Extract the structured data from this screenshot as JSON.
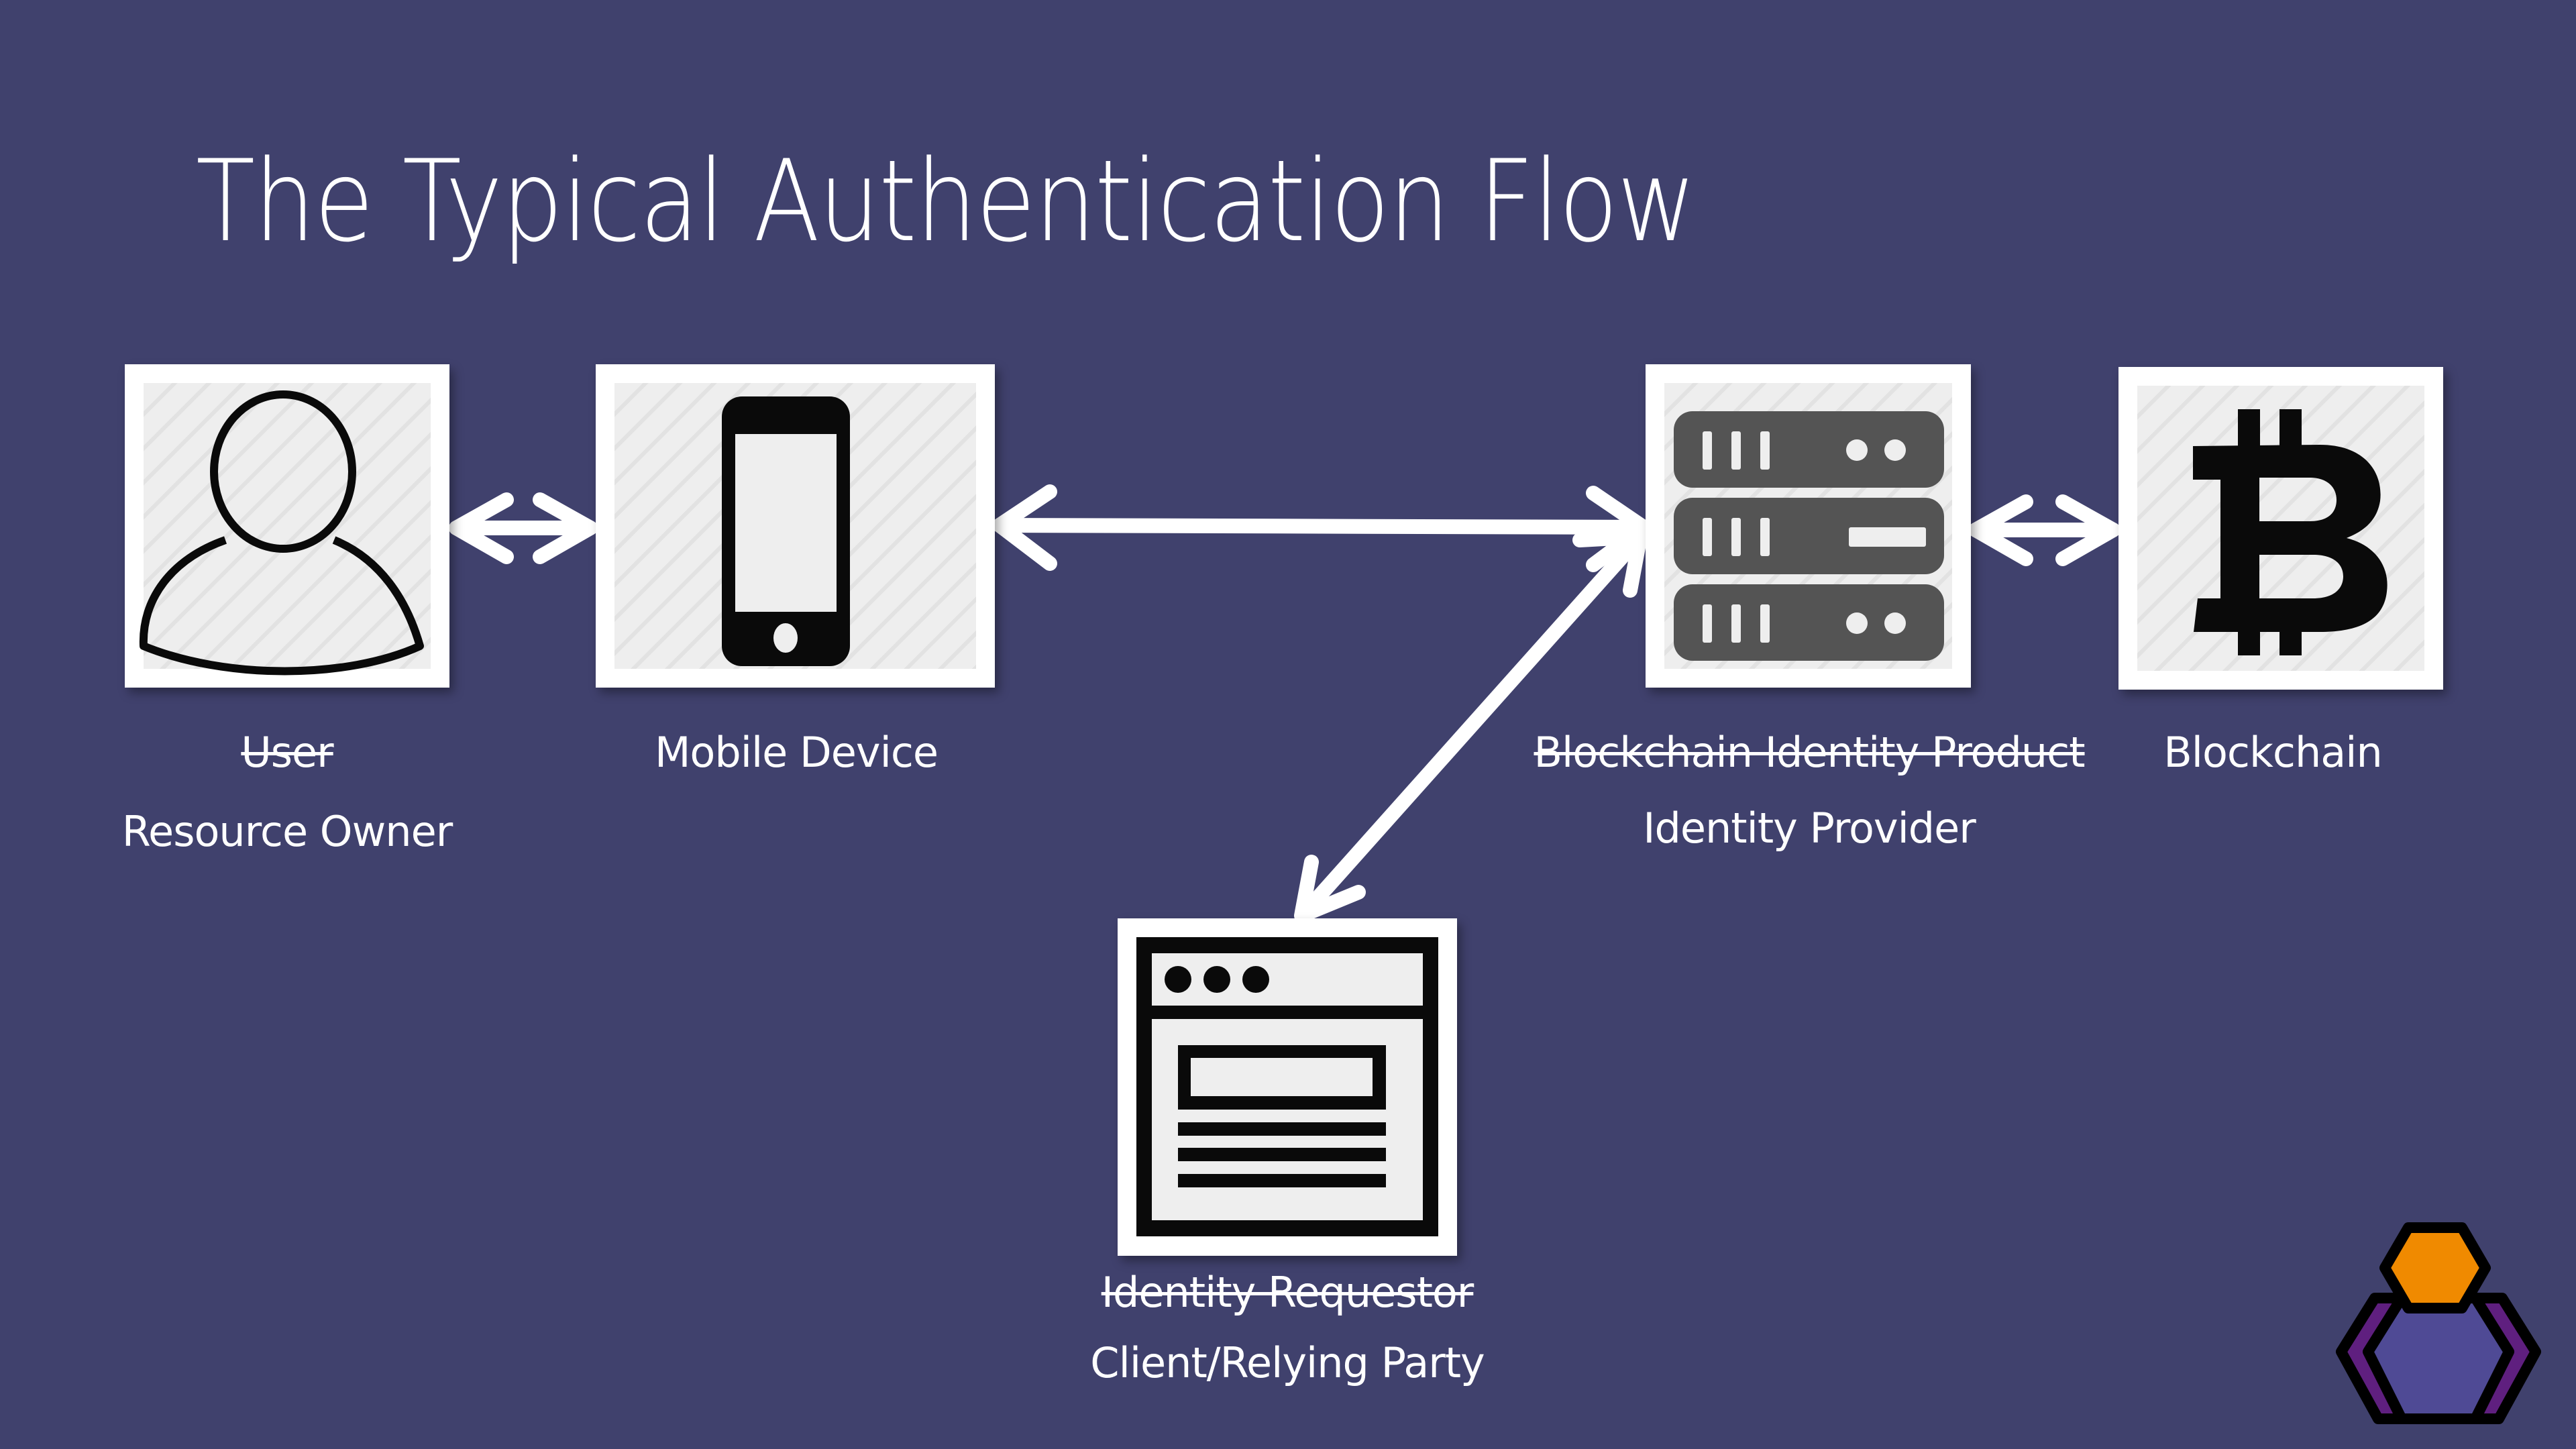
{
  "slide": {
    "title": "The Typical Authentication Flow",
    "background_color": "#40416d"
  },
  "nodes": {
    "user": {
      "icon": "user-icon",
      "old_label": "User",
      "label": "Resource Owner"
    },
    "mobile": {
      "icon": "mobile-phone-icon",
      "label": "Mobile Device"
    },
    "identity_provider": {
      "icon": "server-rack-icon",
      "old_label": "Blockchain Identity Product",
      "label": "Identity Provider"
    },
    "blockchain": {
      "icon": "bitcoin-icon",
      "label": "Blockchain"
    },
    "client": {
      "icon": "browser-window-icon",
      "old_label": "Identity Requestor",
      "label": "Client/Relying Party"
    }
  },
  "connections": [
    {
      "from": "user",
      "to": "mobile",
      "direction": "bidirectional"
    },
    {
      "from": "mobile",
      "to": "identity_provider",
      "direction": "bidirectional"
    },
    {
      "from": "identity_provider",
      "to": "blockchain",
      "direction": "bidirectional"
    },
    {
      "from": "identity_provider",
      "to": "client",
      "direction": "bidirectional"
    }
  ],
  "logo": {
    "icon": "hexagon-logo-icon",
    "colors": {
      "top": "#f08a00",
      "center": "#4f4a95",
      "sides": "#5f1f7f",
      "outline": "#000000"
    }
  }
}
